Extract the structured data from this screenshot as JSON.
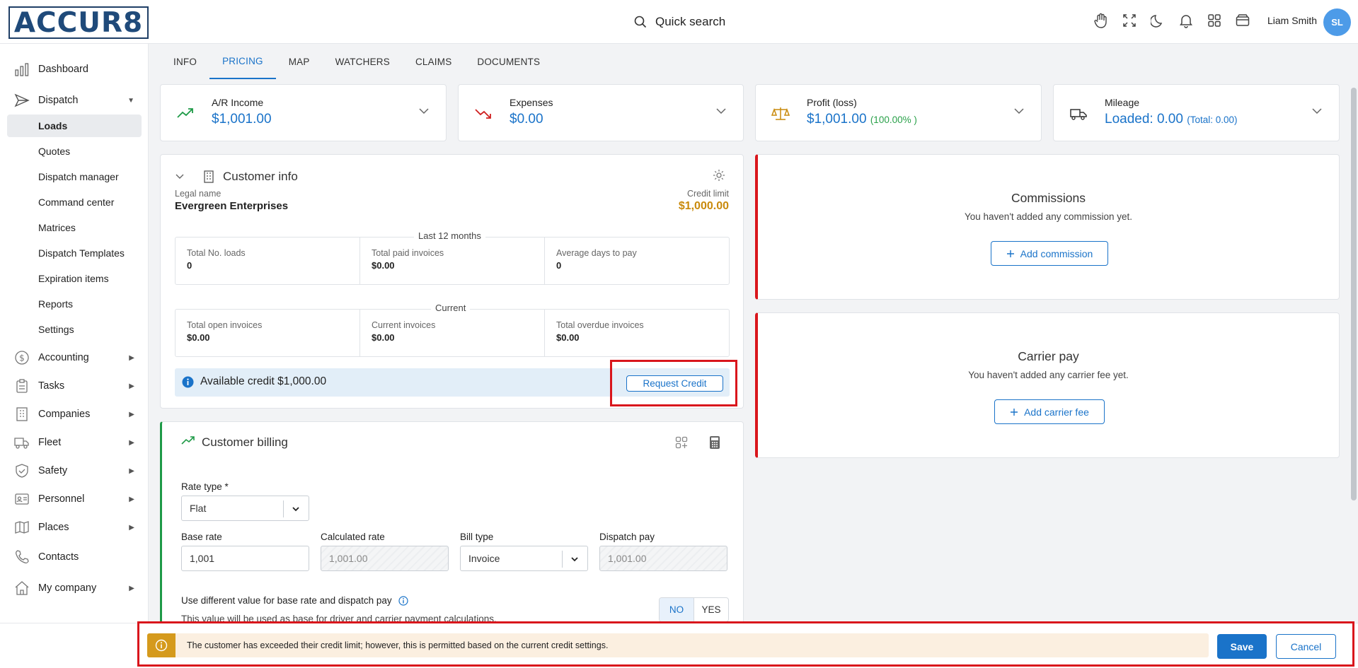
{
  "app": {
    "logo_text": "ACCUR8"
  },
  "search": {
    "label": "Quick search"
  },
  "user": {
    "name": "Liam Smith",
    "initials": "SL"
  },
  "topbar_icons": [
    "hand-icon",
    "fullscreen-icon",
    "moon-icon",
    "bell-icon",
    "apps-grid-icon",
    "wallet-icon"
  ],
  "sidebar": {
    "dashboard": "Dashboard",
    "dispatch": "Dispatch",
    "dispatch_items": [
      "Loads",
      "Quotes",
      "Dispatch manager",
      "Command center",
      "Matrices",
      "Dispatch Templates",
      "Expiration items",
      "Reports",
      "Settings"
    ],
    "accounting": "Accounting",
    "tasks": "Tasks",
    "companies": "Companies",
    "fleet": "Fleet",
    "safety": "Safety",
    "personnel": "Personnel",
    "places": "Places",
    "contacts": "Contacts",
    "my_company": "My company"
  },
  "tabs": [
    "INFO",
    "PRICING",
    "MAP",
    "WATCHERS",
    "CLAIMS",
    "DOCUMENTS"
  ],
  "active_tab": "PRICING",
  "summary": {
    "income": {
      "label": "A/R Income",
      "value": "$1,001.00"
    },
    "expenses": {
      "label": "Expenses",
      "value": "$0.00"
    },
    "profit": {
      "label": "Profit (loss)",
      "value": "$1,001.00",
      "percent": "(100.00% )"
    },
    "mileage": {
      "label": "Mileage",
      "value": "Loaded: 0.00",
      "total": "(Total: 0.00)"
    }
  },
  "customer_info": {
    "title": "Customer info",
    "legal_name_label": "Legal name",
    "legal_name": "Evergreen Enterprises",
    "credit_limit_label": "Credit limit",
    "credit_limit": "$1,000.00",
    "last12_label": "Last 12 months",
    "last12": [
      {
        "label": "Total No. loads",
        "value": "0"
      },
      {
        "label": "Total paid invoices",
        "value": "$0.00"
      },
      {
        "label": "Average days to pay",
        "value": "0"
      }
    ],
    "current_label": "Current",
    "current": [
      {
        "label": "Total open invoices",
        "value": "$0.00"
      },
      {
        "label": "Current invoices",
        "value": "$0.00"
      },
      {
        "label": "Total overdue invoices",
        "value": "$0.00"
      }
    ],
    "available_credit": "Available credit $1,000.00",
    "request_credit": "Request Credit"
  },
  "billing": {
    "title": "Customer billing",
    "rate_type_label": "Rate type *",
    "rate_type": "Flat",
    "base_rate_label": "Base rate",
    "base_rate": "1,001",
    "calculated_rate_label": "Calculated rate",
    "calculated_rate": "1,001.00",
    "bill_type_label": "Bill type",
    "bill_type": "Invoice",
    "dispatch_pay_label": "Dispatch pay",
    "dispatch_pay": "1,001.00",
    "diff_value_label": "Use different value for base rate and dispatch pay",
    "diff_value_hint": "This value will be used as base for driver and carrier payment calculations.",
    "toggle_no": "NO",
    "toggle_yes": "YES",
    "toggle_selected": "NO"
  },
  "commissions": {
    "title": "Commissions",
    "empty": "You haven't added any commission yet.",
    "add": "Add commission"
  },
  "carrier_pay": {
    "title": "Carrier pay",
    "empty": "You haven't added any carrier fee yet.",
    "add": "Add carrier fee"
  },
  "footer": {
    "warning": "The customer has exceeded their credit limit; however, this is permitted based on the current credit settings.",
    "save": "Save",
    "cancel": "Cancel"
  },
  "colors": {
    "accent": "#1a73c9",
    "danger": "#d9161c",
    "warning": "#d59a1c",
    "success": "#2aa14a",
    "credit_limit": "#c98a0c"
  }
}
